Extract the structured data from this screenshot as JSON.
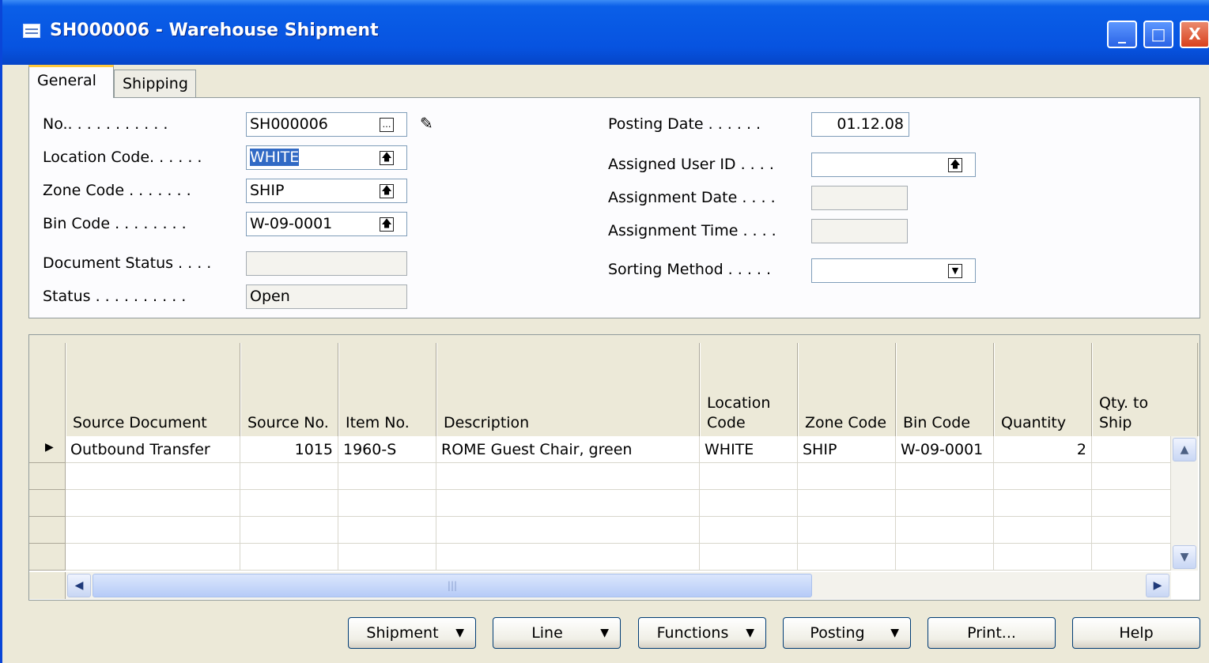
{
  "window": {
    "title": "SH000006 - Warehouse Shipment",
    "controls": {
      "minimize": "_",
      "maximize": "□",
      "close": "X"
    }
  },
  "tabs": [
    {
      "label": "General",
      "active": true
    },
    {
      "label": "Shipping",
      "active": false
    }
  ],
  "general": {
    "no_label": "No.. . . . . . . . . . .",
    "no_value": "SH000006",
    "location_label": "Location Code. . . . . .",
    "location_value": "WHITE",
    "zone_label": "Zone Code . . . . . . .",
    "zone_value": "SHIP",
    "bin_label": "Bin Code . . . . . . . .",
    "bin_value": "W-09-0001",
    "docstatus_label": "Document Status . . . .",
    "docstatus_value": "",
    "status_label": "Status . . . . . . . . . .",
    "status_value": "Open",
    "posting_label": "Posting Date . . . . . .",
    "posting_value": "01.12.08",
    "assigned_user_label": "Assigned User ID . . . .",
    "assigned_user_value": "",
    "assignment_date_label": "Assignment Date . . . .",
    "assignment_date_value": "",
    "assignment_time_label": "Assignment Time . . . .",
    "assignment_time_value": "",
    "sorting_label": "Sorting Method . . . . .",
    "sorting_value": ""
  },
  "lines": {
    "columns": [
      "Source Document",
      "Source No.",
      "Item No.",
      "Description",
      "Location Code",
      "Zone Code",
      "Bin Code",
      "Quantity",
      "Qty. to Ship"
    ],
    "rows": [
      {
        "source_document": "Outbound Transfer",
        "source_no": "1015",
        "item_no": "1960-S",
        "description": "ROME Guest Chair, green",
        "location_code": "WHITE",
        "zone_code": "SHIP",
        "bin_code": "W-09-0001",
        "quantity": "2",
        "qty_to_ship": ""
      }
    ]
  },
  "buttons": {
    "shipment": "Shipment",
    "line": "Line",
    "functions": "Functions",
    "posting": "Posting",
    "print": "Print...",
    "help": "Help"
  }
}
